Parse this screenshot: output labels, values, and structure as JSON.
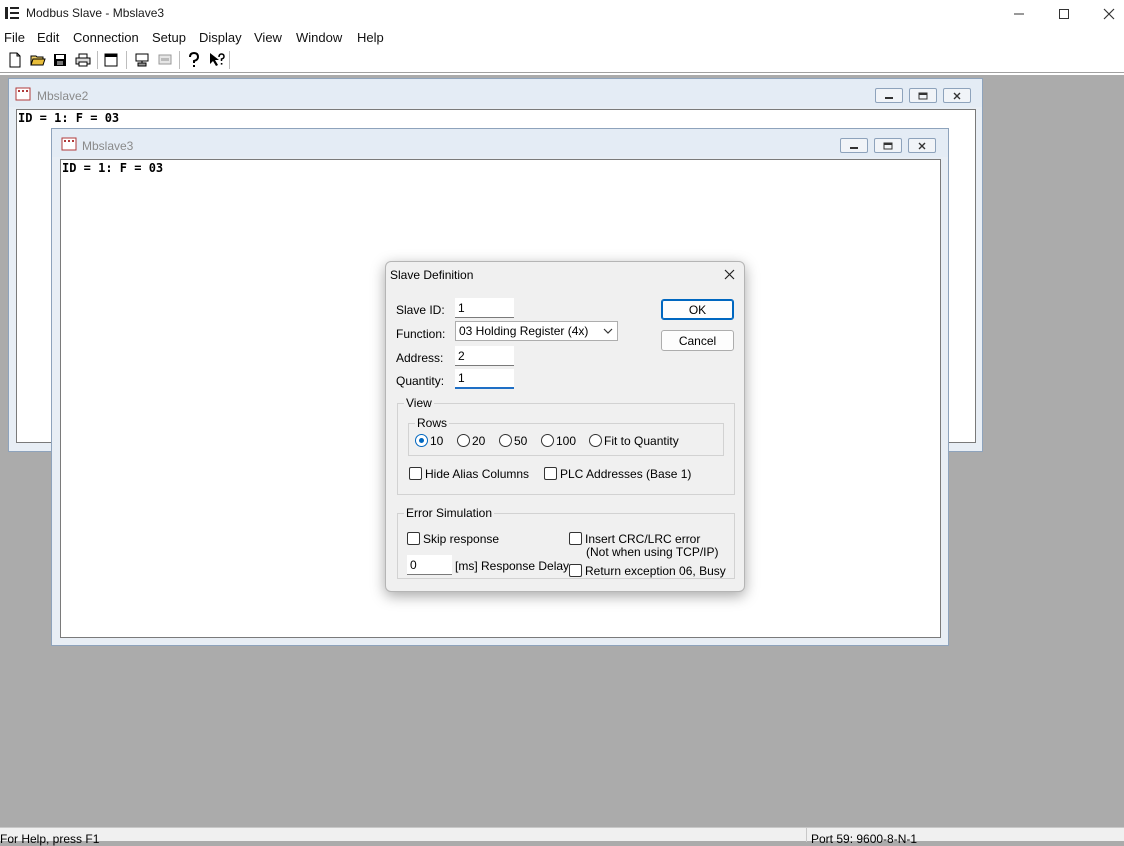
{
  "app": {
    "title": "Modbus Slave - Mbslave3"
  },
  "menu": [
    "File",
    "Edit",
    "Connection",
    "Setup",
    "Display",
    "View",
    "Window",
    "Help"
  ],
  "toolbar": {
    "icons": [
      "new-document-icon",
      "open-folder-icon",
      "save-icon",
      "print-icon",
      "window-icon",
      "connect-icon",
      "disconnect-icon",
      "help-icon",
      "context-help-icon"
    ]
  },
  "windows": {
    "mbslave2": {
      "title": "Mbslave2",
      "id_line": "ID = 1: F = 03"
    },
    "mbslave3": {
      "title": "Mbslave3",
      "id_line": "ID = 1: F = 03"
    }
  },
  "dialog": {
    "title": "Slave Definition",
    "slave_id": {
      "label": "Slave ID:",
      "value": "1"
    },
    "function": {
      "label": "Function:",
      "value": "03 Holding Register (4x)"
    },
    "address": {
      "label": "Address:",
      "value": "2"
    },
    "quantity": {
      "label": "Quantity:",
      "value": "1"
    },
    "ok": "OK",
    "cancel": "Cancel",
    "view": {
      "title": "View",
      "rows_title": "Rows",
      "rows": [
        {
          "label": "10",
          "selected": true
        },
        {
          "label": "20",
          "selected": false
        },
        {
          "label": "50",
          "selected": false
        },
        {
          "label": "100",
          "selected": false
        },
        {
          "label": "Fit to Quantity",
          "selected": false
        }
      ],
      "hide_alias": "Hide Alias Columns",
      "plc_addresses": "PLC Addresses (Base 1)"
    },
    "error_sim": {
      "title": "Error Simulation",
      "skip_response": "Skip response",
      "delay_value": "0",
      "delay_label": "[ms] Response Delay",
      "insert_crc": "Insert CRC/LRC error",
      "insert_crc_note": "(Not when using TCP/IP)",
      "return_exception": "Return exception 06, Busy"
    }
  },
  "status": {
    "left": "For Help, press F1",
    "right": "Port 59: 9600-8-N-1"
  },
  "colors": {
    "accent": "#0067c0",
    "workspace": "#ababab"
  }
}
